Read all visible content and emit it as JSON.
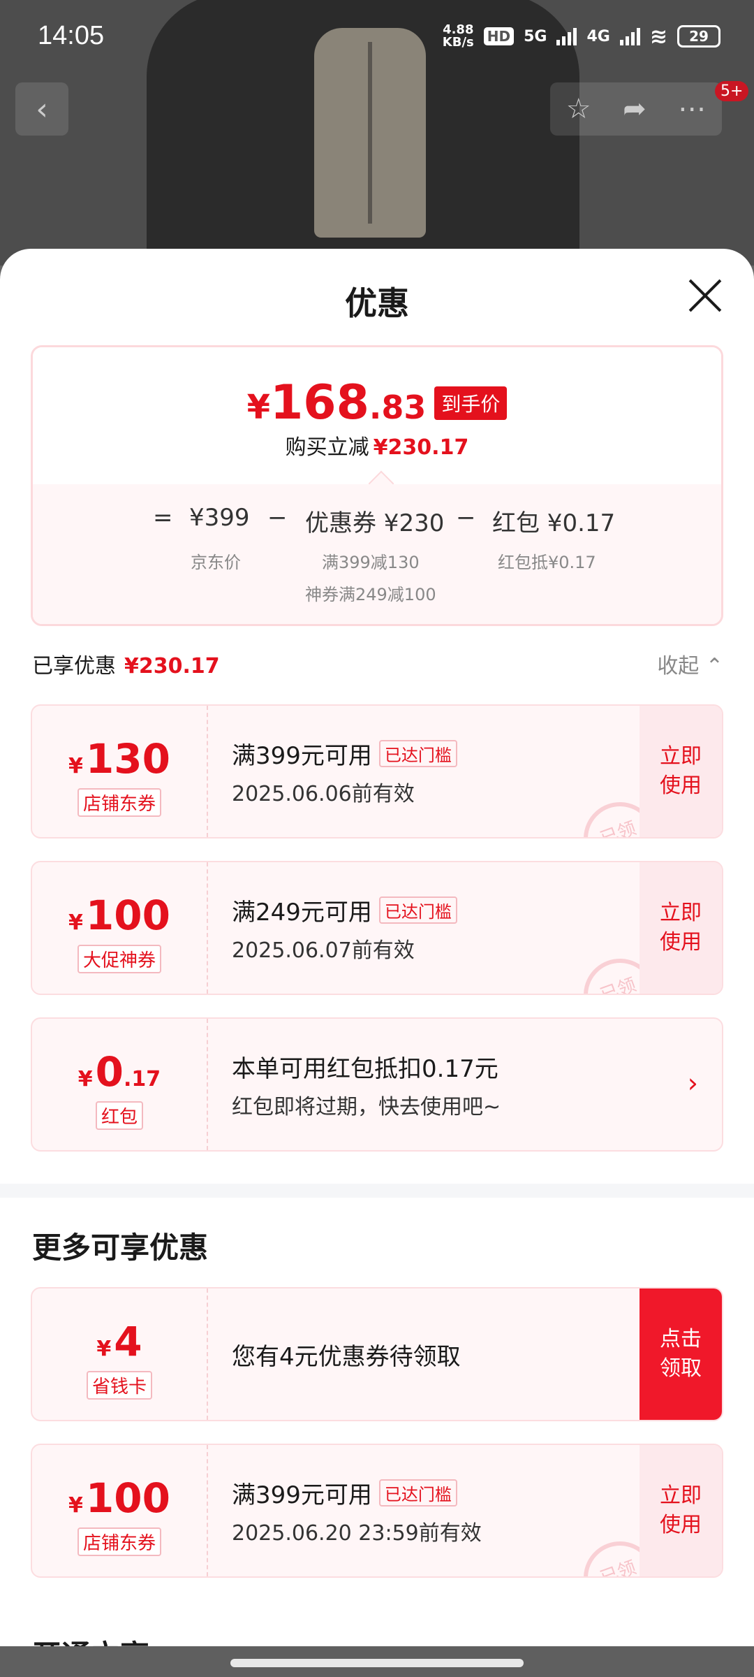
{
  "status_bar": {
    "time": "14:05",
    "speed_value": "4.88",
    "speed_unit": "KB/s",
    "hd": "HD",
    "network_1": "5G",
    "network_2": "4G",
    "battery": "29"
  },
  "nav": {
    "badge": "5+"
  },
  "sheet": {
    "title": "优惠",
    "summary": {
      "yen": "¥",
      "price_int": "168",
      "price_dec": ".83",
      "price_tag": "到手价",
      "reduce_label": "购买立减",
      "reduce_value": "¥230.17",
      "calc": {
        "eq": "=",
        "jd_price": "¥399",
        "minus1": "−",
        "coupon": "优惠券 ¥230",
        "minus2": "−",
        "redpacket": "红包 ¥0.17",
        "jd_label": "京东价",
        "coupon_desc_1": "满399减130",
        "coupon_desc_2": "神券满249减100",
        "redpacket_desc": "红包抵¥0.17"
      }
    },
    "enjoyed": {
      "label": "已享优惠",
      "value": "¥230.17",
      "collapse": "收起 ⌃"
    },
    "enjoyed_coupons": [
      {
        "yen": "¥",
        "amount": "130",
        "dec": "",
        "tag": "店铺东券",
        "condition": "满399元可用",
        "reach": "已达门槛",
        "valid": "2025.06.06前有效",
        "action": "立即使用",
        "stamp": "已领"
      },
      {
        "yen": "¥",
        "amount": "100",
        "dec": "",
        "tag": "大促神券",
        "condition": "满249元可用",
        "reach": "已达门槛",
        "valid": "2025.06.07前有效",
        "action": "立即使用",
        "stamp": "已领"
      },
      {
        "yen": "¥",
        "amount": "0",
        "dec": ".17",
        "tag": "红包",
        "condition": "本单可用红包抵扣0.17元",
        "valid": "红包即将过期，快去使用吧~"
      }
    ],
    "more": {
      "title": "更多可享优惠",
      "items": [
        {
          "yen": "¥",
          "amount": "4",
          "tag": "省钱卡",
          "condition": "您有4元优惠券待领取",
          "action": "点击领取"
        },
        {
          "yen": "¥",
          "amount": "100",
          "tag": "店铺东券",
          "condition": "满399元可用",
          "reach": "已达门槛",
          "valid": "2025.06.20 23:59前有效",
          "action": "立即使用",
          "stamp": "已领"
        }
      ]
    },
    "next_section": "开通立享"
  }
}
